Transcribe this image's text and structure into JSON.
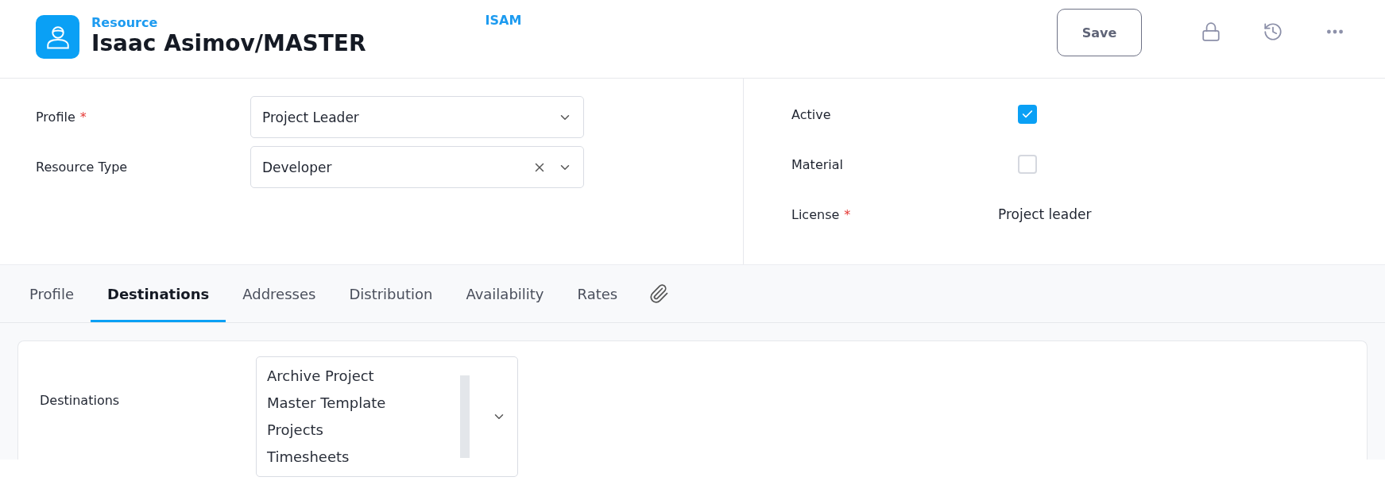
{
  "header": {
    "kicker": "Resource",
    "title": "Isaac Asimov/MASTER",
    "code": "ISAM",
    "save": "Save"
  },
  "left_fields": [
    {
      "label": "Profile",
      "required_mark": "*",
      "kind": "select",
      "value": "Project Leader",
      "clearable": false
    },
    {
      "label": "Resource Type",
      "kind": "select",
      "value": "Developer",
      "clearable": true
    }
  ],
  "right_fields": [
    {
      "label": "Active",
      "kind": "checkbox",
      "checked": true
    },
    {
      "label": "Material",
      "kind": "checkbox",
      "checked": false
    },
    {
      "label": "License",
      "required_mark": "*",
      "kind": "text",
      "value": "Project leader"
    }
  ],
  "tabs": [
    {
      "label": "Profile",
      "selected": false
    },
    {
      "label": "Destinations",
      "selected": true
    },
    {
      "label": "Addresses",
      "selected": false
    },
    {
      "label": "Distribution",
      "selected": false
    },
    {
      "label": "Availability",
      "selected": false
    },
    {
      "label": "Rates",
      "selected": false
    }
  ],
  "destinations": {
    "label": "Destinations",
    "items": [
      "Archive Project",
      "Master Template",
      "Projects",
      "Timesheets"
    ]
  }
}
